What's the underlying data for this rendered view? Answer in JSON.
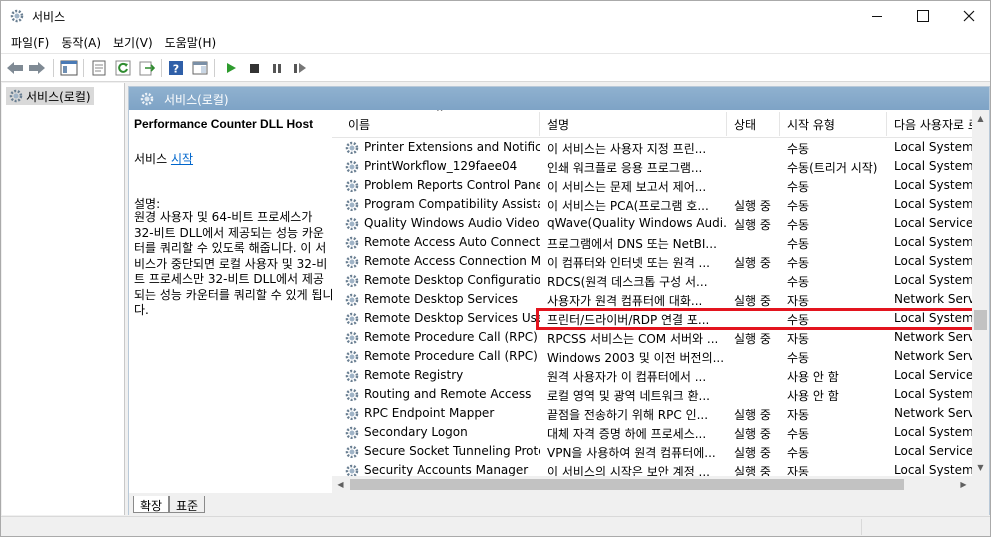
{
  "window": {
    "title": "서비스"
  },
  "menu": [
    "파일(F)",
    "동작(A)",
    "보기(V)",
    "도움말(H)"
  ],
  "tree": {
    "selected_label": "서비스(로컬)"
  },
  "pane": {
    "header_title": "서비스(로컬)",
    "service_title": "Performance Counter DLL Host",
    "action_prefix": "서비스 ",
    "action_link": "시작",
    "desc_label": "설명:",
    "desc_text": "원경 사용자 및 64-비트 프로세스가 32-비트 DLL에서 제공되는 성능 카운터를 쿼리할 수 있도록 해줍니다. 이 서비스가 중단되면 로컬 사용자 및 32-비트 프로세스만 32-비트 DLL에서 제공되는 성능 카운터를 쿼리할 수 있게 됩니다."
  },
  "columns": {
    "name": "이름",
    "description": "설명",
    "status": "상태",
    "startup": "시작 유형",
    "logon": "다음 사용자로 로그온"
  },
  "rows": [
    {
      "name": "Printer Extensions and Notifica...",
      "desc": "이 서비스는 사용자 지정 프린...",
      "status": "",
      "startup": "수동",
      "logon": "Local System"
    },
    {
      "name": "PrintWorkflow_129faee04",
      "desc": "인쇄 워크플로 응용 프로그램...",
      "status": "",
      "startup": "수동(트리거 시작)",
      "logon": "Local System"
    },
    {
      "name": "Problem Reports Control Panel...",
      "desc": "이 서비스는 문제 보고서 제어...",
      "status": "",
      "startup": "수동",
      "logon": "Local System"
    },
    {
      "name": "Program Compatibility Assista...",
      "desc": "이 서비스는 PCA(프로그램 호...",
      "status": "실행 중",
      "startup": "수동",
      "logon": "Local System"
    },
    {
      "name": "Quality Windows Audio Video ...",
      "desc": "qWave(Quality Windows Audi...",
      "status": "실행 중",
      "startup": "수동",
      "logon": "Local Service"
    },
    {
      "name": "Remote Access Auto Connecti...",
      "desc": "프로그램에서 DNS 또는 NetBI...",
      "status": "",
      "startup": "수동",
      "logon": "Local System"
    },
    {
      "name": "Remote Access Connection M...",
      "desc": "이 컴퓨터와 인터넷 또는 원격 ...",
      "status": "실행 중",
      "startup": "수동",
      "logon": "Local System"
    },
    {
      "name": "Remote Desktop Configuration",
      "desc": "RDCS(원격 데스크톱 구성 서...",
      "status": "",
      "startup": "수동",
      "logon": "Local System"
    },
    {
      "name": "Remote Desktop Services",
      "desc": "사용자가 원격 컴퓨터에 대화...",
      "status": "실행 중",
      "startup": "자동",
      "logon": "Network Service"
    },
    {
      "name": "Remote Desktop Services User...",
      "desc": "프린터/드라이버/RDP 연결 포...",
      "status": "",
      "startup": "수동",
      "logon": "Local System"
    },
    {
      "name": "Remote Procedure Call (RPC)",
      "desc": "RPCSS 서비스는 COM 서버와 ...",
      "status": "실행 중",
      "startup": "자동",
      "logon": "Network Service"
    },
    {
      "name": "Remote Procedure Call (RPC) L...",
      "desc": "Windows 2003 및 이전 버전의...",
      "status": "",
      "startup": "수동",
      "logon": "Network Service"
    },
    {
      "name": "Remote Registry",
      "desc": "원격 사용자가 이 컴퓨터에서 ...",
      "status": "",
      "startup": "사용 안 함",
      "logon": "Local Service"
    },
    {
      "name": "Routing and Remote Access",
      "desc": "로컬 영역 및 광역 네트워크 환...",
      "status": "",
      "startup": "사용 안 함",
      "logon": "Local System"
    },
    {
      "name": "RPC Endpoint Mapper",
      "desc": "끝점을 전송하기 위해 RPC 인...",
      "status": "실행 중",
      "startup": "자동",
      "logon": "Network Service"
    },
    {
      "name": "Secondary Logon",
      "desc": "대체 자격 증명 하에 프로세스...",
      "status": "실행 중",
      "startup": "수동",
      "logon": "Local System"
    },
    {
      "name": "Secure Socket Tunneling Proto...",
      "desc": "VPN을 사용하여 원격 컴퓨터에...",
      "status": "실행 중",
      "startup": "수동",
      "logon": "Local Service"
    },
    {
      "name": "Security Accounts Manager",
      "desc": "이 서비스의 시작은 보안 계정 ...",
      "status": "실행 중",
      "startup": "자동",
      "logon": "Local System"
    }
  ],
  "tabs": [
    "확장",
    "표준"
  ]
}
